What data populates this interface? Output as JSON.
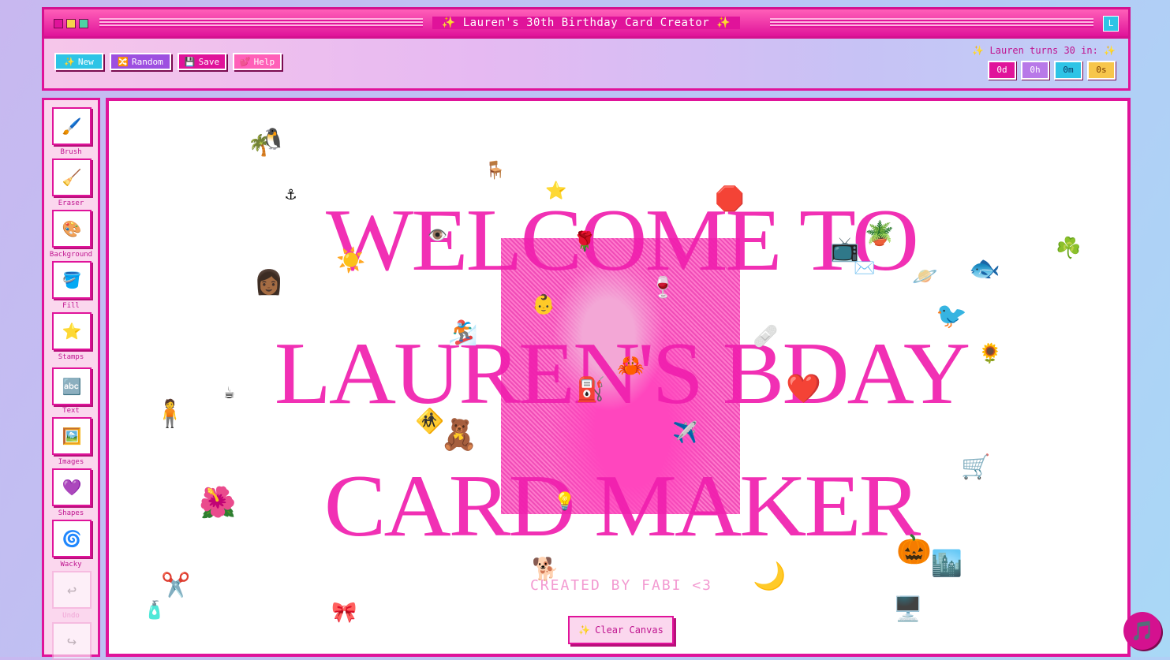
{
  "window": {
    "title": "Lauren's 30th Birthday Card Creator",
    "title_decoration": "✨",
    "user_initial": "L"
  },
  "toolbar": {
    "buttons": [
      {
        "label": "New",
        "icon": "✨",
        "color": "#2ec4e6"
      },
      {
        "label": "Random",
        "icon": "🔀",
        "color": "#9d4fe0"
      },
      {
        "label": "Save",
        "icon": "💾",
        "color": "#e0139a"
      },
      {
        "label": "Help",
        "icon": "💕",
        "color": "#ff5fb8"
      }
    ],
    "countdown": {
      "label": "Lauren turns 30 in:",
      "label_icon": "✨",
      "days": "0d",
      "hours": "0h",
      "minutes": "0m",
      "seconds": "0s"
    }
  },
  "sidebar": {
    "tools": [
      {
        "label": "Brush",
        "icon": "🖌️"
      },
      {
        "label": "Eraser",
        "icon": "🧹"
      },
      {
        "label": "Background",
        "icon": "🎨"
      },
      {
        "label": "Fill",
        "icon": "🪣"
      },
      {
        "label": "Stamps",
        "icon": "⭐"
      },
      {
        "label": "Text",
        "icon": "🔤"
      },
      {
        "label": "Images",
        "icon": "🖼️"
      },
      {
        "label": "Shapes",
        "icon": "💜"
      },
      {
        "label": "Wacky",
        "icon": "🌀"
      },
      {
        "label": "Undo",
        "icon": "↩"
      },
      {
        "label": "Redo",
        "icon": "↪"
      }
    ]
  },
  "canvas": {
    "headline_lines": [
      "WELCOME TO",
      "LAUREN'S BDAY",
      "CARD MAKER"
    ],
    "credit": "CREATED BY FABI <3",
    "clear_button": {
      "label": "Clear Canvas",
      "icon": "✨"
    },
    "stickers": [
      "🌴",
      "🐧",
      "🪑",
      "⭐",
      "🛑",
      "⚓",
      "☀️",
      "👁️",
      "🌹",
      "📺",
      "🪴",
      "✉️",
      "🪐",
      "🐟",
      "☘️",
      "👩🏾",
      "🍷",
      "👶",
      "🏂",
      "🩹",
      "🐦",
      "🌻",
      "☕",
      "🧍",
      "🦀",
      "⛽",
      "❤️",
      "🚸",
      "🧸",
      "✈️",
      "🛒",
      "🌺",
      "💡",
      "🎃",
      "🏙️",
      "🐕",
      "🌙",
      "✂️",
      "🧴",
      "🎀",
      "🖥️"
    ]
  },
  "music": {
    "icon": "🎵"
  }
}
